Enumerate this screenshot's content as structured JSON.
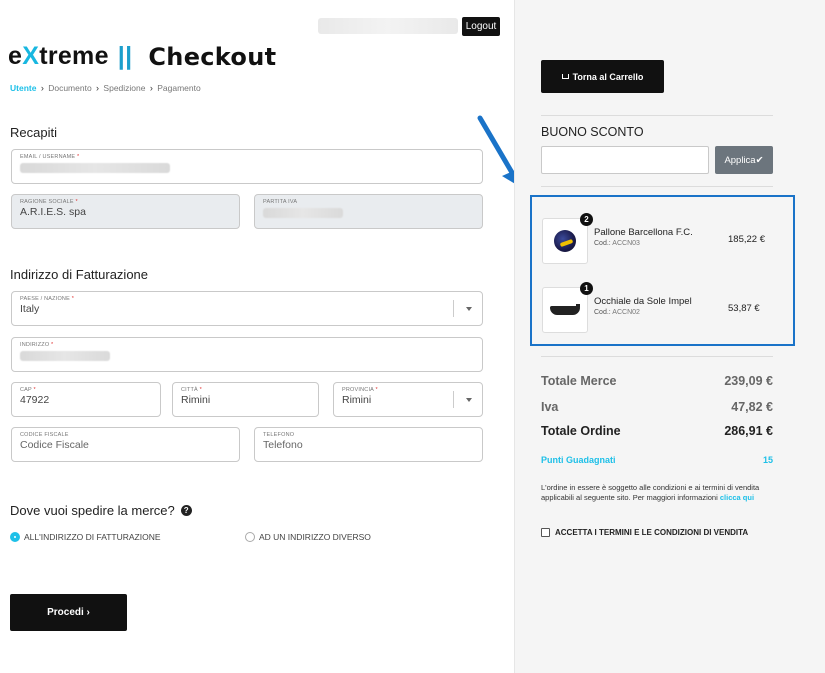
{
  "header": {
    "logout_label": "Logout",
    "brand": {
      "prefix": "e",
      "x": "X",
      "suffix": "treme",
      "bars": "||",
      "page": "Checkout"
    }
  },
  "breadcrumb": {
    "items": [
      "Utente",
      "Documento",
      "Spedizione",
      "Pagamento"
    ],
    "separator": "›"
  },
  "contacts": {
    "title": "Recapiti",
    "email": {
      "label": "EMAIL / USERNAME",
      "required_mark": "*"
    },
    "company": {
      "label": "RAGIONE SOCIALE",
      "required_mark": "*",
      "value": "A.R.I.E.S. spa"
    },
    "vat": {
      "label": "PARTITA IVA"
    }
  },
  "billing": {
    "title": "Indirizzo di Fatturazione",
    "country": {
      "label": "PAESE / NAZIONE",
      "required_mark": "*",
      "value": "Italy"
    },
    "address": {
      "label": "INDIRIZZO",
      "required_mark": "*"
    },
    "zip": {
      "label": "CAP",
      "required_mark": "*",
      "value": "47922"
    },
    "city": {
      "label": "CITTÀ",
      "required_mark": "*",
      "value": "Rimini"
    },
    "province": {
      "label": "PROVINCIA",
      "required_mark": "*",
      "value": "Rimini"
    },
    "tax_code": {
      "label": "CODICE FISCALE",
      "placeholder": "Codice Fiscale"
    },
    "phone": {
      "label": "TELEFONO",
      "placeholder": "Telefono"
    }
  },
  "shipping": {
    "question": "Dove vuoi spedire la merce?",
    "help_icon": "question-circle-icon",
    "options": [
      {
        "label": "ALL'INDIRIZZO DI FATTURAZIONE",
        "selected": true
      },
      {
        "label": "AD UN INDIRIZZO DIVERSO",
        "selected": false
      }
    ]
  },
  "actions": {
    "proceed_label": "Procedi ›"
  },
  "sidebar": {
    "back_label": "Torna al Carrello",
    "coupon": {
      "title": "BUONO SCONTO",
      "apply_label": "Applica✔"
    },
    "cart": [
      {
        "qty": "2",
        "name": "Pallone Barcellona F.C.",
        "code_label": "Cod.:",
        "code": "ACCN03",
        "price": "185,22 €",
        "image": "football"
      },
      {
        "qty": "1",
        "name": "Occhiale da Sole Impel",
        "code_label": "Cod.:",
        "code": "ACCN02",
        "price": "53,87 €",
        "image": "sunglasses"
      }
    ],
    "totals": {
      "goods_label": "Totale Merce",
      "goods_value": "239,09 €",
      "vat_label": "Iva",
      "vat_value": "47,82 €",
      "order_label": "Totale Ordine",
      "order_value": "286,91 €",
      "points_label": "Punti Guadagnati",
      "points_value": "15"
    },
    "terms": {
      "text": "L'ordine in essere è soggetto alle condizioni e ai termini di vendita applicabili al seguente sito. Per maggiori informazioni",
      "link": "clicca qui",
      "accept_label": "ACCETTA I TERMINI E LE CONDIZIONI DI VENDITA"
    }
  },
  "colors": {
    "accent": "#1ec0e8",
    "highlight_box": "#1a73c8",
    "dark_button": "#111111"
  }
}
